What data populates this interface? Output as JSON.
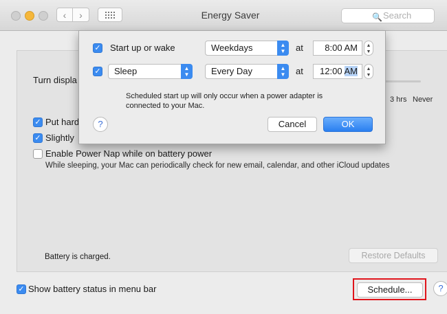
{
  "window": {
    "title": "Energy Saver",
    "search_placeholder": "Search",
    "back_icon": "‹",
    "forward_icon": "›"
  },
  "main": {
    "turn_display_label": "Turn displa",
    "slider_ticks": [
      "3 hrs",
      "Never"
    ],
    "options": [
      {
        "label": "Put hard",
        "checked": true
      },
      {
        "label": "Slightly",
        "checked": true
      },
      {
        "label": "Enable Power Nap while on battery power",
        "checked": false
      }
    ],
    "power_nap_note": "While sleeping, your Mac can periodically check for new email, calendar, and other iCloud updates",
    "battery_status": "Battery is charged.",
    "restore_defaults_label": "Restore Defaults",
    "show_battery_label": "Show battery status in menu bar",
    "show_battery_checked": true,
    "schedule_label": "Schedule...",
    "help_label": "?"
  },
  "dialog": {
    "row1": {
      "checked": true,
      "action_label": "Start up or wake",
      "day": "Weekdays",
      "at_label": "at",
      "time": "8:00 AM"
    },
    "row2": {
      "checked": true,
      "action": "Sleep",
      "day": "Every Day",
      "at_label": "at",
      "time_hour": "12:00",
      "time_ampm": "AM"
    },
    "note": "Scheduled start up will only occur when a power adapter is connected to your Mac.",
    "cancel_label": "Cancel",
    "ok_label": "OK",
    "help_label": "?"
  },
  "colors": {
    "accent": "#3b8bf0",
    "highlight_box": "#e0141b"
  }
}
